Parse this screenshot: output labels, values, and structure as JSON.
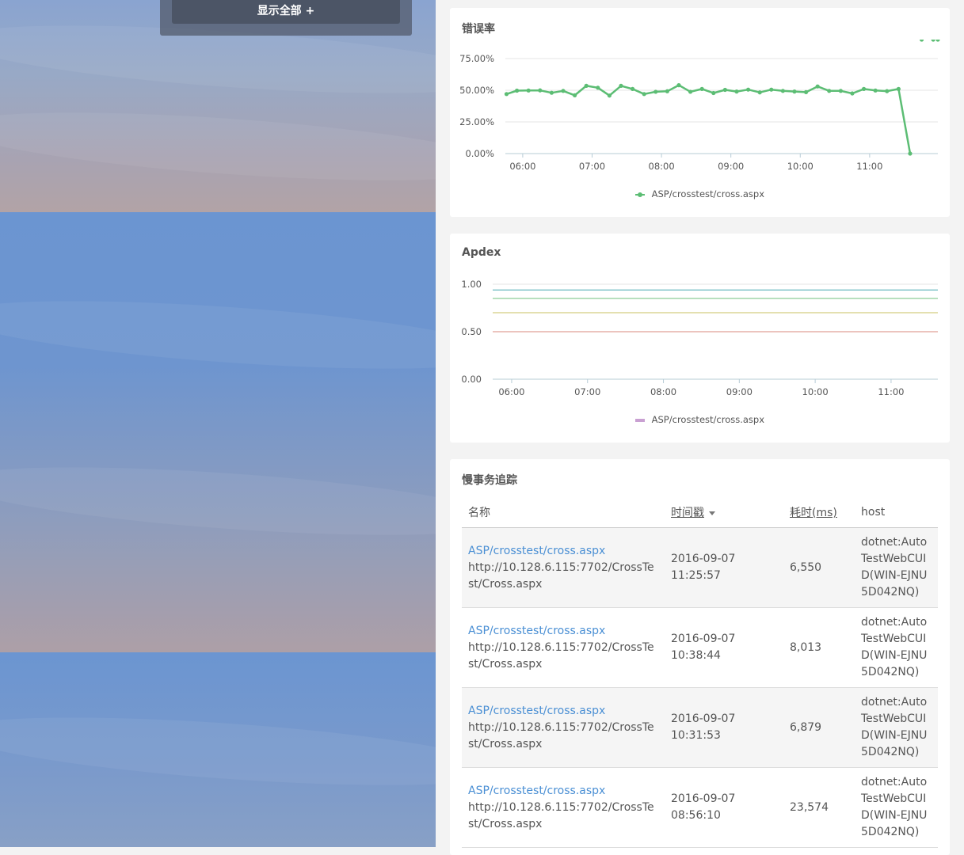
{
  "sidebar": {
    "show_all_label": "显示全部 +"
  },
  "error_rate_panel": {
    "title": "错误率",
    "legend": "ASP/crosstest/cross.aspx",
    "color": "#5cbd74",
    "chart_data": {
      "type": "line",
      "title": "错误率",
      "x_tick_labels": [
        "06:00",
        "07:00",
        "08:00",
        "09:00",
        "10:00",
        "11:00"
      ],
      "y_tick_labels": [
        "0.00%",
        "25.00%",
        "50.00%",
        "75.00%"
      ],
      "ylim": [
        0,
        75
      ],
      "xlim_minutes": [
        345,
        719
      ],
      "grid": true,
      "legend_position": "bottom",
      "series": [
        {
          "name": "ASP/crosstest/cross.aspx",
          "color": "#5cbd74",
          "x_minutes": [
            346,
            355,
            365,
            375,
            385,
            395,
            405,
            415,
            425,
            435,
            445,
            455,
            465,
            475,
            485,
            495,
            505,
            515,
            525,
            535,
            545,
            555,
            565,
            575,
            585,
            595,
            605,
            615,
            625,
            635,
            645,
            655,
            665,
            675,
            685,
            695,
            705,
            715,
            719
          ],
          "y": [
            47,
            49.7,
            49.8,
            49.9,
            48,
            49.5,
            46,
            53.5,
            52,
            45.8,
            53.5,
            51,
            47,
            48.8,
            49.2,
            54,
            48.8,
            51,
            47.8,
            50.3,
            49,
            50.5,
            48.3,
            50.5,
            49.5,
            49,
            48.5,
            53,
            49.5,
            49.5,
            47.5,
            51,
            49.8,
            49.3,
            51,
            0
          ]
        }
      ]
    }
  },
  "apdex_panel": {
    "title": "Apdex",
    "legend": "ASP/crosstest/cross.aspx",
    "legend_color": "#c9a0d2",
    "chart_data": {
      "type": "line",
      "title": "Apdex",
      "x_tick_labels": [
        "06:00",
        "07:00",
        "08:00",
        "09:00",
        "10:00",
        "11:00"
      ],
      "y_tick_labels": [
        "0.00",
        "0.50",
        "1.00"
      ],
      "ylim": [
        0,
        1
      ],
      "xlim_minutes": [
        345,
        697
      ],
      "legend_position": "bottom",
      "reference_lines": [
        {
          "y": 0.94,
          "color": "#46a8b0"
        },
        {
          "y": 0.85,
          "color": "#6fc27c"
        },
        {
          "y": 0.7,
          "color": "#c9c062"
        },
        {
          "y": 0.5,
          "color": "#d98a7e"
        }
      ],
      "series": [
        {
          "name": "ASP/crosstest/cross.aspx",
          "color": "#c9a0d2",
          "x_minutes": [],
          "y": []
        }
      ]
    }
  },
  "slow_trace_panel": {
    "title": "慢事务追踪",
    "columns": {
      "name": "名称",
      "timestamp": "时间戳",
      "duration": "耗时(ms)",
      "host": "host"
    },
    "rows": [
      {
        "name": "ASP/crosstest/cross.aspx",
        "url": "http://10.128.6.115:7702/CrossTest/Cross.aspx",
        "timestamp": "2016-09-07 11:25:57",
        "duration": "6,550",
        "host": "dotnet:AutoTestWebCUID(WIN-EJNU5D042NQ)"
      },
      {
        "name": "ASP/crosstest/cross.aspx",
        "url": "http://10.128.6.115:7702/CrossTest/Cross.aspx",
        "timestamp": "2016-09-07 10:38:44",
        "duration": "8,013",
        "host": "dotnet:AutoTestWebCUID(WIN-EJNU5D042NQ)"
      },
      {
        "name": "ASP/crosstest/cross.aspx",
        "url": "http://10.128.6.115:7702/CrossTest/Cross.aspx",
        "timestamp": "2016-09-07 10:31:53",
        "duration": "6,879",
        "host": "dotnet:AutoTestWebCUID(WIN-EJNU5D042NQ)"
      },
      {
        "name": "ASP/crosstest/cross.aspx",
        "url": "http://10.128.6.115:7702/CrossTest/Cross.aspx",
        "timestamp": "2016-09-07 08:56:10",
        "duration": "23,574",
        "host": "dotnet:AutoTestWebCUID(WIN-EJNU5D042NQ)"
      }
    ]
  }
}
